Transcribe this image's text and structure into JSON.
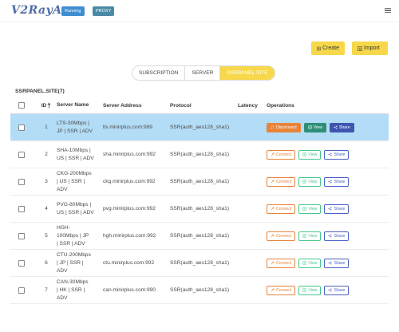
{
  "navbar": {
    "brand": "V2RayA",
    "status_running": "Running",
    "status_proxy": "PROXY"
  },
  "actions": {
    "create_label": "Create",
    "import_label": "Import"
  },
  "tabs": [
    {
      "label": "SUBSCRIPTION",
      "active": false
    },
    {
      "label": "SERVER",
      "active": false
    },
    {
      "label": "SSRPANEL.SITE",
      "active": true
    }
  ],
  "section_title": "SSRPANEL.SITE(7)",
  "table": {
    "headers": {
      "id": "ID",
      "sort_icon": "sort-up-icon",
      "name": "Server Name",
      "address": "Server Address",
      "protocol": "Protocol",
      "latency": "Latency",
      "operations": "Operations"
    },
    "op_labels": {
      "connect": "Connect",
      "disconnect": "Disconnect",
      "view": "View",
      "share": "Share"
    },
    "rows": [
      {
        "id": "1",
        "name_lines": [
          "LTS-30Mbps |",
          "JP | SSR | ADV"
        ],
        "address": "lts.minirplus.com:989",
        "protocol": "SSR(auth_aes128_sha1)",
        "latency": "",
        "connected": true
      },
      {
        "id": "2",
        "name_lines": [
          "SHA-10Mbps |",
          "US | SSR | ADV"
        ],
        "address": "sha.minirplus.com:992",
        "protocol": "SSR(auth_aes128_sha1)",
        "latency": "",
        "connected": false
      },
      {
        "id": "3",
        "name_lines": [
          "CKG-200Mbps",
          "| US | SSR |",
          "ADV"
        ],
        "address": "ckg.minirplus.com:992",
        "protocol": "SSR(auth_aes128_sha1)",
        "latency": "",
        "connected": false
      },
      {
        "id": "4",
        "name_lines": [
          "PVG-80Mbps |",
          "US | SSR | ADV"
        ],
        "address": "pvg.minirplus.com:992",
        "protocol": "SSR(auth_aes128_sha1)",
        "latency": "",
        "connected": false
      },
      {
        "id": "5",
        "name_lines": [
          "HGH-",
          "100Mbps | JP",
          "| SSR | ADV"
        ],
        "address": "hgh.minirplus.com:992",
        "protocol": "SSR(auth_aes128_sha1)",
        "latency": "",
        "connected": false
      },
      {
        "id": "6",
        "name_lines": [
          "CTU-200Mbps",
          "| JP | SSR |",
          "ADV"
        ],
        "address": "ctu.minirplus.com:992",
        "protocol": "SSR(auth_aes128_sha1)",
        "latency": "",
        "connected": false
      },
      {
        "id": "7",
        "name_lines": [
          "CAN-30Mbps",
          "| HK | SSR |",
          "ADV"
        ],
        "address": "can.minirplus.com:990",
        "protocol": "SSR(auth_aes128_sha1)",
        "latency": "",
        "connected": false
      }
    ]
  },
  "colors": {
    "accent_yellow": "#f6d84a",
    "selected_row": "#b3dcf6",
    "connect_orange": "#e8843a",
    "view_green": "#48c78e",
    "share_blue": "#485fc7"
  }
}
